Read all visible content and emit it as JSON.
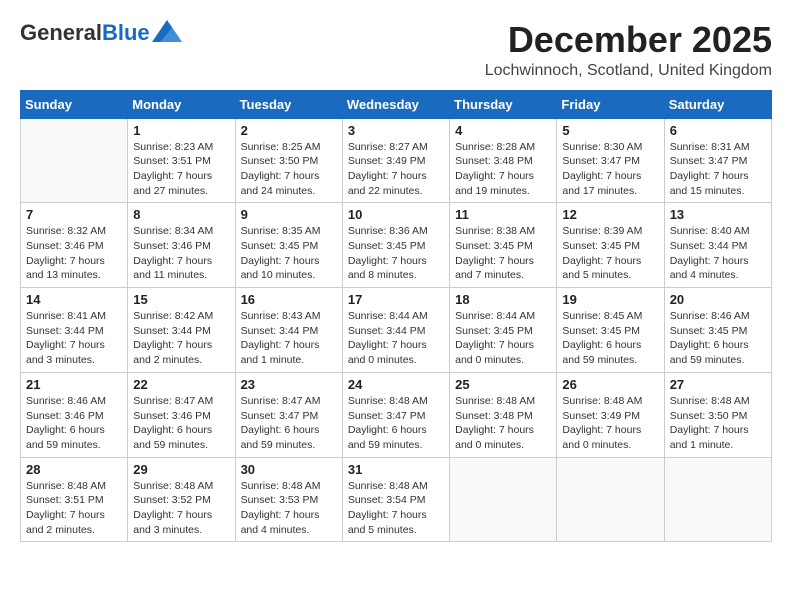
{
  "header": {
    "logo_general": "General",
    "logo_blue": "Blue",
    "month_title": "December 2025",
    "location": "Lochwinnoch, Scotland, United Kingdom"
  },
  "weekdays": [
    "Sunday",
    "Monday",
    "Tuesday",
    "Wednesday",
    "Thursday",
    "Friday",
    "Saturday"
  ],
  "weeks": [
    [
      {
        "day": "",
        "info": ""
      },
      {
        "day": "1",
        "info": "Sunrise: 8:23 AM\nSunset: 3:51 PM\nDaylight: 7 hours\nand 27 minutes."
      },
      {
        "day": "2",
        "info": "Sunrise: 8:25 AM\nSunset: 3:50 PM\nDaylight: 7 hours\nand 24 minutes."
      },
      {
        "day": "3",
        "info": "Sunrise: 8:27 AM\nSunset: 3:49 PM\nDaylight: 7 hours\nand 22 minutes."
      },
      {
        "day": "4",
        "info": "Sunrise: 8:28 AM\nSunset: 3:48 PM\nDaylight: 7 hours\nand 19 minutes."
      },
      {
        "day": "5",
        "info": "Sunrise: 8:30 AM\nSunset: 3:47 PM\nDaylight: 7 hours\nand 17 minutes."
      },
      {
        "day": "6",
        "info": "Sunrise: 8:31 AM\nSunset: 3:47 PM\nDaylight: 7 hours\nand 15 minutes."
      }
    ],
    [
      {
        "day": "7",
        "info": "Sunrise: 8:32 AM\nSunset: 3:46 PM\nDaylight: 7 hours\nand 13 minutes."
      },
      {
        "day": "8",
        "info": "Sunrise: 8:34 AM\nSunset: 3:46 PM\nDaylight: 7 hours\nand 11 minutes."
      },
      {
        "day": "9",
        "info": "Sunrise: 8:35 AM\nSunset: 3:45 PM\nDaylight: 7 hours\nand 10 minutes."
      },
      {
        "day": "10",
        "info": "Sunrise: 8:36 AM\nSunset: 3:45 PM\nDaylight: 7 hours\nand 8 minutes."
      },
      {
        "day": "11",
        "info": "Sunrise: 8:38 AM\nSunset: 3:45 PM\nDaylight: 7 hours\nand 7 minutes."
      },
      {
        "day": "12",
        "info": "Sunrise: 8:39 AM\nSunset: 3:45 PM\nDaylight: 7 hours\nand 5 minutes."
      },
      {
        "day": "13",
        "info": "Sunrise: 8:40 AM\nSunset: 3:44 PM\nDaylight: 7 hours\nand 4 minutes."
      }
    ],
    [
      {
        "day": "14",
        "info": "Sunrise: 8:41 AM\nSunset: 3:44 PM\nDaylight: 7 hours\nand 3 minutes."
      },
      {
        "day": "15",
        "info": "Sunrise: 8:42 AM\nSunset: 3:44 PM\nDaylight: 7 hours\nand 2 minutes."
      },
      {
        "day": "16",
        "info": "Sunrise: 8:43 AM\nSunset: 3:44 PM\nDaylight: 7 hours\nand 1 minute."
      },
      {
        "day": "17",
        "info": "Sunrise: 8:44 AM\nSunset: 3:44 PM\nDaylight: 7 hours\nand 0 minutes."
      },
      {
        "day": "18",
        "info": "Sunrise: 8:44 AM\nSunset: 3:45 PM\nDaylight: 7 hours\nand 0 minutes."
      },
      {
        "day": "19",
        "info": "Sunrise: 8:45 AM\nSunset: 3:45 PM\nDaylight: 6 hours\nand 59 minutes."
      },
      {
        "day": "20",
        "info": "Sunrise: 8:46 AM\nSunset: 3:45 PM\nDaylight: 6 hours\nand 59 minutes."
      }
    ],
    [
      {
        "day": "21",
        "info": "Sunrise: 8:46 AM\nSunset: 3:46 PM\nDaylight: 6 hours\nand 59 minutes."
      },
      {
        "day": "22",
        "info": "Sunrise: 8:47 AM\nSunset: 3:46 PM\nDaylight: 6 hours\nand 59 minutes."
      },
      {
        "day": "23",
        "info": "Sunrise: 8:47 AM\nSunset: 3:47 PM\nDaylight: 6 hours\nand 59 minutes."
      },
      {
        "day": "24",
        "info": "Sunrise: 8:48 AM\nSunset: 3:47 PM\nDaylight: 6 hours\nand 59 minutes."
      },
      {
        "day": "25",
        "info": "Sunrise: 8:48 AM\nSunset: 3:48 PM\nDaylight: 7 hours\nand 0 minutes."
      },
      {
        "day": "26",
        "info": "Sunrise: 8:48 AM\nSunset: 3:49 PM\nDaylight: 7 hours\nand 0 minutes."
      },
      {
        "day": "27",
        "info": "Sunrise: 8:48 AM\nSunset: 3:50 PM\nDaylight: 7 hours\nand 1 minute."
      }
    ],
    [
      {
        "day": "28",
        "info": "Sunrise: 8:48 AM\nSunset: 3:51 PM\nDaylight: 7 hours\nand 2 minutes."
      },
      {
        "day": "29",
        "info": "Sunrise: 8:48 AM\nSunset: 3:52 PM\nDaylight: 7 hours\nand 3 minutes."
      },
      {
        "day": "30",
        "info": "Sunrise: 8:48 AM\nSunset: 3:53 PM\nDaylight: 7 hours\nand 4 minutes."
      },
      {
        "day": "31",
        "info": "Sunrise: 8:48 AM\nSunset: 3:54 PM\nDaylight: 7 hours\nand 5 minutes."
      },
      {
        "day": "",
        "info": ""
      },
      {
        "day": "",
        "info": ""
      },
      {
        "day": "",
        "info": ""
      }
    ]
  ]
}
